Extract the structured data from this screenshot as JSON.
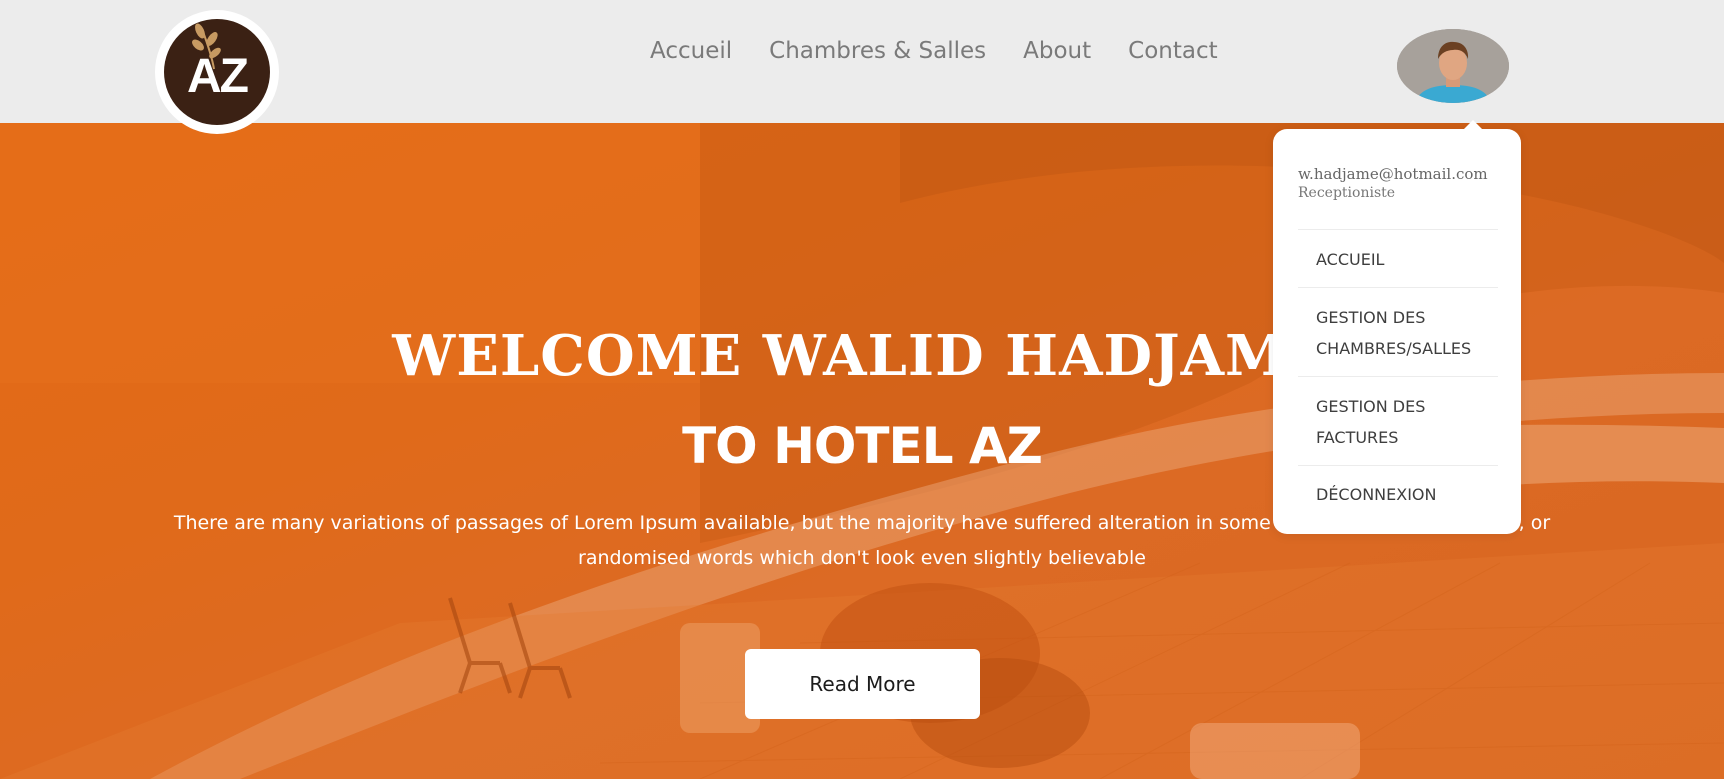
{
  "header": {
    "logo_text": "AZ",
    "nav": [
      {
        "label": "Accueil"
      },
      {
        "label": "Chambres & Salles"
      },
      {
        "label": "About"
      },
      {
        "label": "Contact"
      }
    ]
  },
  "hero": {
    "title": "WELCOME WALID HADJAME",
    "subtitle": "TO HOTEL AZ",
    "text": "There are many variations of passages of Lorem Ipsum available, but the majority have suffered alteration in some form, by injected humour, or randomised words which don't look even slightly believable",
    "button_label": "Read More"
  },
  "user_menu": {
    "email": "w.hadjame@hotmail.com",
    "role": "Receptioniste",
    "items": [
      {
        "label": "ACCUEIL"
      },
      {
        "label": "GESTION DES CHAMBRES/SALLES"
      },
      {
        "label": "GESTION DES FACTURES"
      },
      {
        "label": "DÉCONNEXION"
      }
    ]
  },
  "colors": {
    "hero_orange": "#e06a1a",
    "header_bg": "#ececec",
    "logo_brown": "#3b2114",
    "nav_text": "#7a7a7a"
  },
  "icons": {
    "logo": "olive-branch-logo",
    "avatar": "user-avatar-photo"
  }
}
